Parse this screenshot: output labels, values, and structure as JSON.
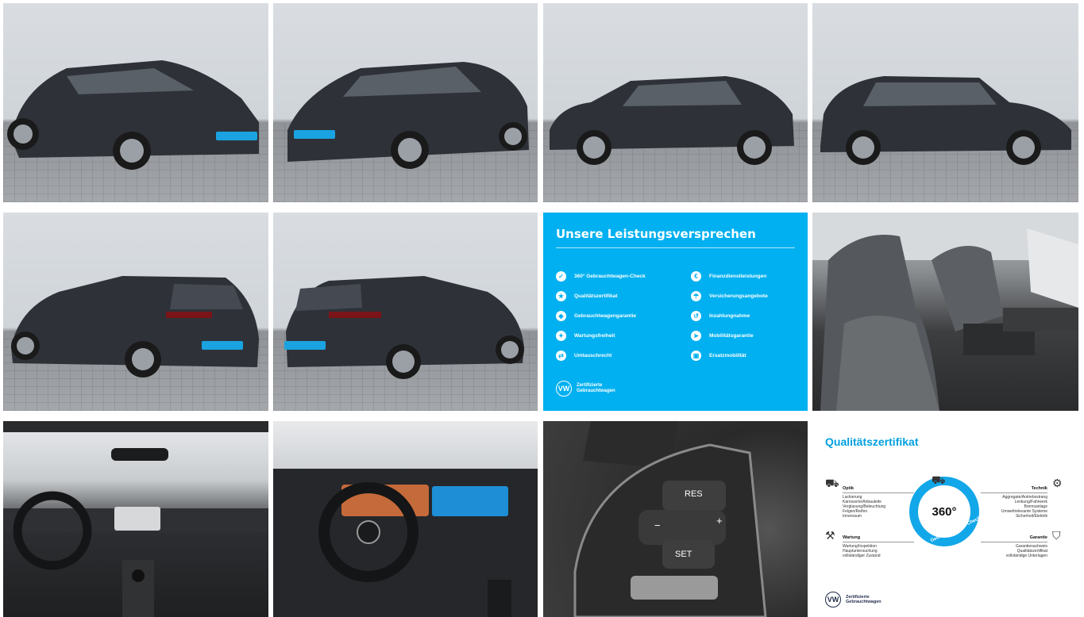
{
  "gallery": {
    "photos": [
      {
        "name": "front-left-exterior"
      },
      {
        "name": "front-right-exterior"
      },
      {
        "name": "left-side-exterior"
      },
      {
        "name": "right-side-exterior"
      },
      {
        "name": "rear-left-exterior"
      },
      {
        "name": "rear-right-exterior"
      },
      {
        "name": "front-seats"
      },
      {
        "name": "dashboard-overview"
      },
      {
        "name": "steering-wheel-cockpit"
      },
      {
        "name": "steering-wheel-buttons"
      }
    ],
    "wheel_buttons": {
      "res": "RES",
      "set": "SET",
      "minus": "−",
      "plus": "+"
    }
  },
  "promo": {
    "title": "Unsere Leistungsversprechen",
    "left_items": [
      "360° Gebrauchtwagen-Check",
      "Qualitätszertifikat",
      "Gebrauchtwagengarantie",
      "Wartungsfreiheit",
      "Umtauschrecht"
    ],
    "right_items": [
      "Finanzdienstleistungen",
      "Versicherungsangebote",
      "Inzahlungnahme",
      "Mobilitätsgarantie",
      "Ersatzmobilität"
    ],
    "brand_line1": "Zertifizierte",
    "brand_line2": "Gebrauchtwagen",
    "logo": "VW",
    "accent_color": "#00b0f0"
  },
  "certificate": {
    "title": "Qualitätszertifikat",
    "ring_value": "360°",
    "ring_label": "Gebrauchtwagen-Check",
    "optik": {
      "title": "Optik",
      "items": [
        "Lackierung",
        "Karosserie/Anbauteile",
        "Verglasung/Beleuchtung",
        "Felgen/Reifen",
        "Innenraum"
      ]
    },
    "technik": {
      "title": "Technik",
      "items": [
        "Aggregate/Antriebsstrang",
        "Lenkung/Fahrwerk",
        "Bremsanlage",
        "Umweltrelevante Systeme",
        "Sicherheit/Elektrik"
      ]
    },
    "wartung": {
      "title": "Wartung",
      "items": [
        "Wartung/Inspektion",
        "Hauptuntersuchung",
        "vollständiger Zustand"
      ]
    },
    "garantie": {
      "title": "Garantie",
      "items": [
        "Garantienachweis",
        "Qualitätszertifikat",
        "vollständige Unterlagen"
      ]
    },
    "brand_line1": "Zertifizierte",
    "brand_line2": "Gebrauchtwagen",
    "logo": "VW",
    "accent_color": "#00a0e0"
  }
}
